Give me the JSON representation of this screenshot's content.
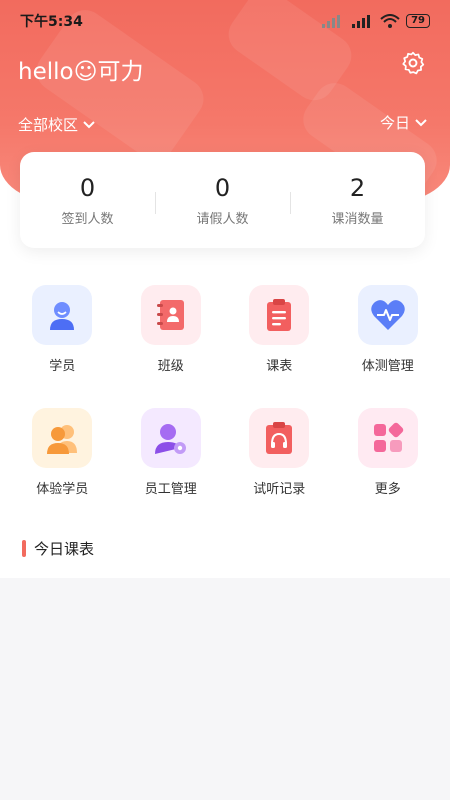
{
  "status": {
    "time": "下午5:34",
    "battery": "79"
  },
  "header": {
    "greeting": "hello☺可力",
    "campus": "全部校区",
    "date_filter": "今日"
  },
  "stats": [
    {
      "value": "0",
      "label": "签到人数"
    },
    {
      "value": "0",
      "label": "请假人数"
    },
    {
      "value": "2",
      "label": "课消数量"
    }
  ],
  "menu": [
    {
      "label": "学员",
      "icon": "student-icon"
    },
    {
      "label": "班级",
      "icon": "class-icon"
    },
    {
      "label": "课表",
      "icon": "schedule-icon"
    },
    {
      "label": "体测管理",
      "icon": "heart-icon"
    },
    {
      "label": "体验学员",
      "icon": "trial-student-icon"
    },
    {
      "label": "员工管理",
      "icon": "staff-icon"
    },
    {
      "label": "试听记录",
      "icon": "trial-record-icon"
    },
    {
      "label": "更多",
      "icon": "more-icon"
    }
  ],
  "section": {
    "title": "今日课表"
  },
  "colors": {
    "brand": "#f26b5e"
  }
}
